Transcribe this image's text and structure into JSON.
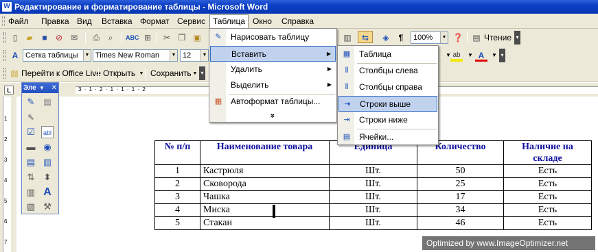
{
  "window": {
    "title": "Редактирование и форматирование таблицы - Microsoft Word",
    "app_icon": "W"
  },
  "menubar": {
    "items": [
      "Файл",
      "Правка",
      "Вид",
      "Вставка",
      "Формат",
      "Сервис",
      "Таблица",
      "Окно",
      "Справка"
    ],
    "active": "Таблица"
  },
  "toolbar_standard": {
    "zoom": "100%",
    "reading_label": "Чтение"
  },
  "toolbar_formatting": {
    "style": "Сетка таблицы",
    "font": "Times New Roman",
    "size": "12"
  },
  "toolbar_web": {
    "office_live": "Перейти к Office Live",
    "open": "Открыть",
    "save": "Сохранить"
  },
  "float_toolbar": {
    "title": "Эле"
  },
  "ruler": {
    "numbers": "3 · 1 · 2 · 1 · 1 · 1 · 2",
    "vnumbers": [
      "1",
      "2",
      "3",
      "4",
      "5",
      "6",
      "7"
    ]
  },
  "table_menu": {
    "items": [
      {
        "label": "Нарисовать таблицу",
        "icon": "pencil-icon"
      },
      {
        "label": "Вставить",
        "icon": "",
        "submenu": true
      },
      {
        "label": "Удалить",
        "icon": "",
        "submenu": true
      },
      {
        "label": "Выделить",
        "icon": "",
        "submenu": true
      },
      {
        "label": "Автоформат таблицы...",
        "icon": "autoformat-icon"
      }
    ],
    "expand": "»"
  },
  "insert_submenu": {
    "items": [
      {
        "label": "Таблица",
        "icon": "table-icon"
      },
      {
        "label": "Столбцы слева",
        "icon": "columns-left-icon"
      },
      {
        "label": "Столбцы справа",
        "icon": "columns-right-icon"
      },
      {
        "label": "Строки выше",
        "icon": "rows-above-icon"
      },
      {
        "label": "Строки ниже",
        "icon": "rows-below-icon"
      },
      {
        "label": "Ячейки...",
        "icon": "cells-icon"
      }
    ],
    "highlighted": "Строки выше"
  },
  "doc_table": {
    "headers": [
      "№ п/п",
      "Наименование товара",
      "Единица",
      "Количество",
      "Наличие на складе"
    ],
    "rows": [
      [
        "1",
        "Кастрюля",
        "Шт.",
        "50",
        "Есть"
      ],
      [
        "2",
        "Сковорода",
        "Шт.",
        "25",
        "Есть"
      ],
      [
        "3",
        "Чашка",
        "Шт.",
        "17",
        "Есть"
      ],
      [
        "4",
        "Миска",
        "Шт.",
        "34",
        "Есть"
      ],
      [
        "5",
        "Стакан",
        "Шт.",
        "46",
        "Есть"
      ]
    ]
  },
  "watermark": "Optimized by www.ImageOptimizer.net",
  "colors": {
    "titlebar": "#0a3ec4",
    "menu_highlight": "#c1d2ee",
    "header_text": "#1010a0"
  }
}
